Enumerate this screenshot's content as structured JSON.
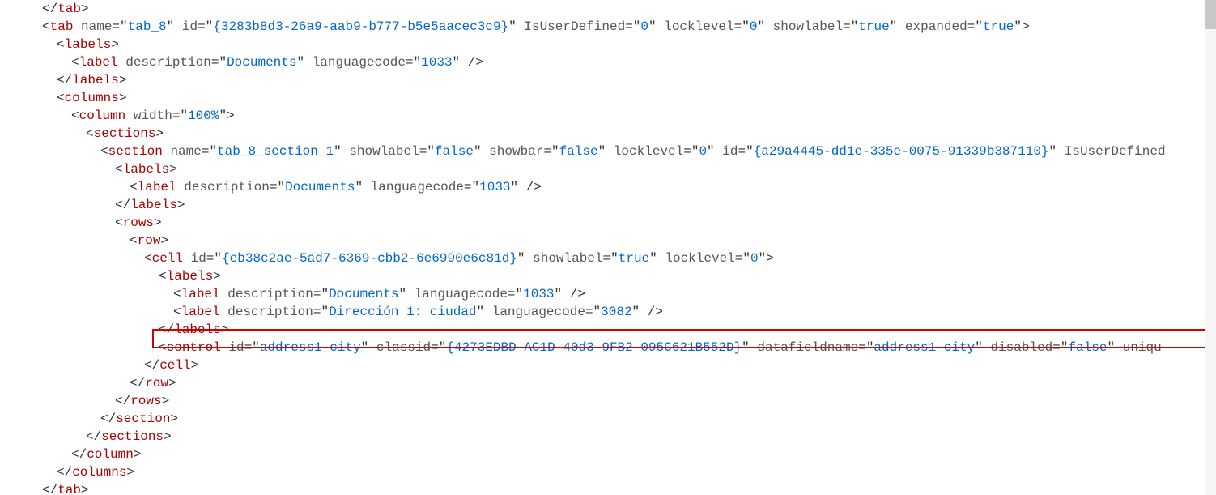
{
  "lines": [
    {
      "indent": 0,
      "html": "<span class='punct'>&lt;/</span><span class='name'>tab</span><span class='punct'>&gt;</span>"
    },
    {
      "indent": 0,
      "html": "<span class='punct'>&lt;</span><span class='name'>tab</span> <span class='attr'>name</span><span class='punct'>=&quot;</span><span class='val'>tab_8</span><span class='punct'>&quot;</span> <span class='attr'>id</span><span class='punct'>=&quot;</span><span class='val'>{3283b8d3-26a9-aab9-b777-b5e5aacec3c9}</span><span class='punct'>&quot;</span> <span class='attr'>IsUserDefined</span><span class='punct'>=&quot;</span><span class='val'>0</span><span class='punct'>&quot;</span> <span class='attr'>locklevel</span><span class='punct'>=&quot;</span><span class='val'>0</span><span class='punct'>&quot;</span> <span class='attr'>showlabel</span><span class='punct'>=&quot;</span><span class='val'>true</span><span class='punct'>&quot;</span> <span class='attr'>expanded</span><span class='punct'>=&quot;</span><span class='val'>true</span><span class='punct'>&quot;&gt;</span>"
    },
    {
      "indent": 1,
      "html": "<span class='punct'>&lt;</span><span class='name'>labels</span><span class='punct'>&gt;</span>"
    },
    {
      "indent": 2,
      "html": "<span class='punct'>&lt;</span><span class='name'>label</span> <span class='attr'>description</span><span class='punct'>=&quot;</span><span class='val'>Documents</span><span class='punct'>&quot;</span> <span class='attr'>languagecode</span><span class='punct'>=&quot;</span><span class='val'>1033</span><span class='punct'>&quot;</span> <span class='punct'>/&gt;</span>"
    },
    {
      "indent": 1,
      "html": "<span class='punct'>&lt;/</span><span class='name'>labels</span><span class='punct'>&gt;</span>"
    },
    {
      "indent": 1,
      "html": "<span class='punct'>&lt;</span><span class='name'>columns</span><span class='punct'>&gt;</span>"
    },
    {
      "indent": 2,
      "html": "<span class='punct'>&lt;</span><span class='name'>column</span> <span class='attr'>width</span><span class='punct'>=&quot;</span><span class='val'>100%</span><span class='punct'>&quot;&gt;</span>"
    },
    {
      "indent": 3,
      "html": "<span class='punct'>&lt;</span><span class='name'>sections</span><span class='punct'>&gt;</span>"
    },
    {
      "indent": 4,
      "html": "<span class='punct'>&lt;</span><span class='name'>section</span> <span class='attr'>name</span><span class='punct'>=&quot;</span><span class='val'>tab_8_section_1</span><span class='punct'>&quot;</span> <span class='attr'>showlabel</span><span class='punct'>=&quot;</span><span class='val'>false</span><span class='punct'>&quot;</span> <span class='attr'>showbar</span><span class='punct'>=&quot;</span><span class='val'>false</span><span class='punct'>&quot;</span> <span class='attr'>locklevel</span><span class='punct'>=&quot;</span><span class='val'>0</span><span class='punct'>&quot;</span> <span class='attr'>id</span><span class='punct'>=&quot;</span><span class='val'>{a29a4445-dd1e-335e-0075-91339b387110}</span><span class='punct'>&quot;</span> <span class='attr'>IsUserDefined</span>"
    },
    {
      "indent": 5,
      "html": "<span class='punct'>&lt;</span><span class='name'>labels</span><span class='punct'>&gt;</span>"
    },
    {
      "indent": 6,
      "html": "<span class='punct'>&lt;</span><span class='name'>label</span> <span class='attr'>description</span><span class='punct'>=&quot;</span><span class='val'>Documents</span><span class='punct'>&quot;</span> <span class='attr'>languagecode</span><span class='punct'>=&quot;</span><span class='val'>1033</span><span class='punct'>&quot;</span> <span class='punct'>/&gt;</span>"
    },
    {
      "indent": 5,
      "html": "<span class='punct'>&lt;/</span><span class='name'>labels</span><span class='punct'>&gt;</span>"
    },
    {
      "indent": 5,
      "html": "<span class='punct'>&lt;</span><span class='name'>rows</span><span class='punct'>&gt;</span>"
    },
    {
      "indent": 6,
      "html": "<span class='punct'>&lt;</span><span class='name'>row</span><span class='punct'>&gt;</span>"
    },
    {
      "indent": 7,
      "html": "<span class='punct'>&lt;</span><span class='name'>cell</span> <span class='attr'>id</span><span class='punct'>=&quot;</span><span class='val'>{eb38c2ae-5ad7-6369-cbb2-6e6990e6c81d}</span><span class='punct'>&quot;</span> <span class='attr'>showlabel</span><span class='punct'>=&quot;</span><span class='val'>true</span><span class='punct'>&quot;</span> <span class='attr'>locklevel</span><span class='punct'>=&quot;</span><span class='val'>0</span><span class='punct'>&quot;&gt;</span>"
    },
    {
      "indent": 8,
      "html": "<span class='punct'>&lt;</span><span class='name'>labels</span><span class='punct'>&gt;</span>"
    },
    {
      "indent": 9,
      "html": "<span class='punct'>&lt;</span><span class='name'>label</span> <span class='attr'>description</span><span class='punct'>=&quot;</span><span class='val'>Documents</span><span class='punct'>&quot;</span> <span class='attr'>languagecode</span><span class='punct'>=&quot;</span><span class='val'>1033</span><span class='punct'>&quot;</span> <span class='punct'>/&gt;</span>"
    },
    {
      "indent": 9,
      "html": "<span class='punct'>&lt;</span><span class='name'>label</span> <span class='attr'>description</span><span class='punct'>=&quot;</span><span class='val'>Dirección 1: ciudad</span><span class='punct'>&quot;</span> <span class='attr'>languagecode</span><span class='punct'>=&quot;</span><span class='val'>3082</span><span class='punct'>&quot;</span> <span class='punct'>/&gt;</span>"
    },
    {
      "indent": 8,
      "html": "<span class='punct'>&lt;/</span><span class='name'>labels</span><span class='punct'>&gt;</span>"
    },
    {
      "indent": 8,
      "cursor": true,
      "html": "<span class='punct'>&lt;</span><span class='name'>control</span> <span class='attr'>id</span><span class='punct'>=&quot;</span><span class='val'>address1_city</span><span class='punct'>&quot;</span> <span class='attr'>classid</span><span class='punct'>=&quot;</span><span class='val'>{4273EDBD-AC1D-40d3-9FB2-095C621B552D}</span><span class='punct'>&quot;</span> <span class='attr'>datafieldname</span><span class='punct'>=&quot;</span><span class='val'>address1_city</span><span class='punct'>&quot;</span> <span class='attr'>disabled</span><span class='punct'>=&quot;</span><span class='val'>false</span><span class='punct'>&quot;</span> <span class='attr'>uniqu</span>"
    },
    {
      "indent": 7,
      "html": "<span class='punct'>&lt;/</span><span class='name'>cell</span><span class='punct'>&gt;</span>"
    },
    {
      "indent": 6,
      "html": "<span class='punct'>&lt;/</span><span class='name'>row</span><span class='punct'>&gt;</span>"
    },
    {
      "indent": 5,
      "html": "<span class='punct'>&lt;/</span><span class='name'>rows</span><span class='punct'>&gt;</span>"
    },
    {
      "indent": 4,
      "html": "<span class='punct'>&lt;/</span><span class='name'>section</span><span class='punct'>&gt;</span>"
    },
    {
      "indent": 3,
      "html": "<span class='punct'>&lt;/</span><span class='name'>sections</span><span class='punct'>&gt;</span>"
    },
    {
      "indent": 2,
      "html": "<span class='punct'>&lt;/</span><span class='name'>column</span><span class='punct'>&gt;</span>"
    },
    {
      "indent": 1,
      "html": "<span class='punct'>&lt;/</span><span class='name'>columns</span><span class='punct'>&gt;</span>"
    },
    {
      "indent": 0,
      "html": "<span class='punct'>&lt;/</span><span class='name'>tab</span><span class='punct'>&gt;</span>"
    }
  ],
  "indentWidth": 18,
  "highlight": {
    "color": "#d40000"
  }
}
